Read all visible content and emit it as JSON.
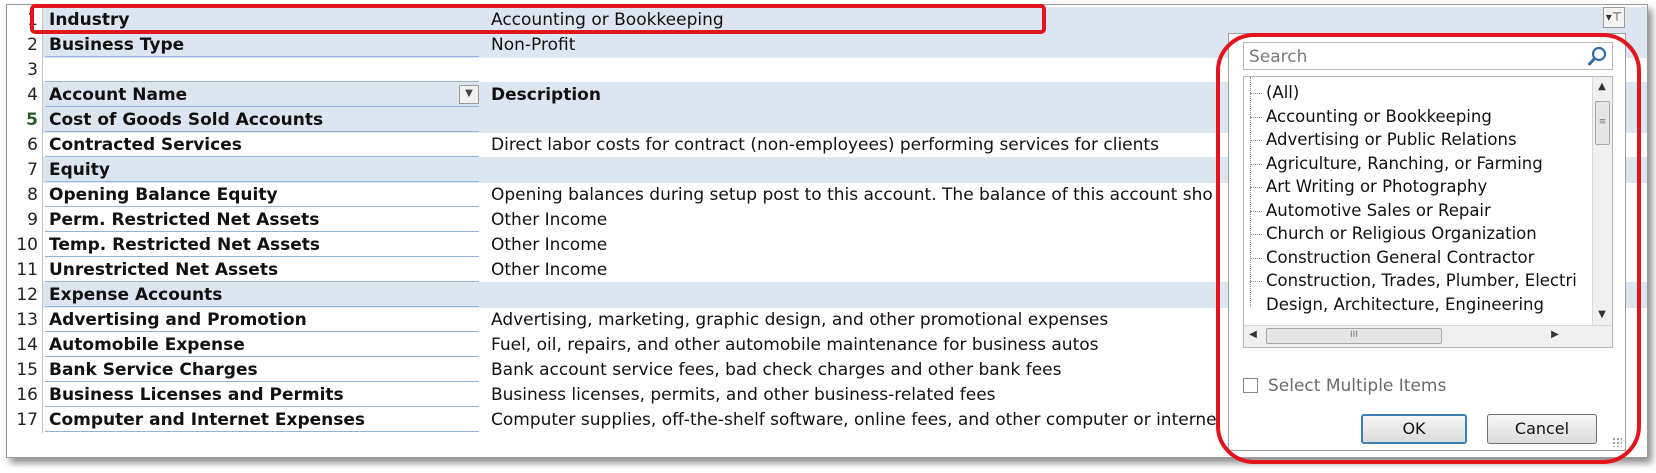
{
  "sheet": {
    "rows": [
      {
        "num": "1",
        "a": "Industry",
        "b": "Accounting or Bookkeeping",
        "band": true,
        "sel": false
      },
      {
        "num": "2",
        "a": "Business Type",
        "b": "Non-Profit",
        "band": true,
        "sel": false
      },
      {
        "num": "3",
        "a": "",
        "b": "",
        "band": false,
        "sel": false
      },
      {
        "num": "4",
        "a": "Account Name",
        "b": "Description",
        "band": true,
        "sel": false
      },
      {
        "num": "5",
        "a": "Cost of Goods Sold Accounts",
        "b": "",
        "band": true,
        "sel": true
      },
      {
        "num": "6",
        "a": "Contracted Services",
        "b": "Direct labor costs for contract (non-employees) performing services for clients",
        "band": false,
        "sel": false
      },
      {
        "num": "7",
        "a": "Equity",
        "b": "",
        "band": true,
        "sel": false
      },
      {
        "num": "8",
        "a": "Opening Balance Equity",
        "b": "Opening balances during setup post to this account. The balance of this account sho",
        "band": false,
        "sel": false
      },
      {
        "num": "9",
        "a": "Perm. Restricted Net Assets",
        "b": "Other Income",
        "band": false,
        "sel": false
      },
      {
        "num": "10",
        "a": "Temp. Restricted Net Assets",
        "b": "Other Income",
        "band": false,
        "sel": false
      },
      {
        "num": "11",
        "a": "Unrestricted Net Assets",
        "b": "Other Income",
        "band": false,
        "sel": false
      },
      {
        "num": "12",
        "a": "Expense Accounts",
        "b": "",
        "band": true,
        "sel": false
      },
      {
        "num": "13",
        "a": "Advertising and Promotion",
        "b": "Advertising, marketing, graphic design, and other promotional expenses",
        "band": false,
        "sel": false
      },
      {
        "num": "14",
        "a": "Automobile Expense",
        "b": "Fuel, oil, repairs, and other automobile maintenance for business autos",
        "band": false,
        "sel": false
      },
      {
        "num": "15",
        "a": "Bank Service Charges",
        "b": "Bank account service fees, bad check charges and other bank fees",
        "band": false,
        "sel": false
      },
      {
        "num": "16",
        "a": "Business Licenses and Permits",
        "b": "Business licenses, permits, and other business-related fees",
        "band": false,
        "sel": false
      },
      {
        "num": "17",
        "a": "Computer and Internet Expenses",
        "b": "Computer supplies, off-the-shelf software, online fees, and other computer or interne",
        "band": false,
        "sel": false
      }
    ]
  },
  "filter_panel": {
    "search_placeholder": "Search",
    "items": [
      "(All)",
      "Accounting or Bookkeeping",
      "Advertising or Public Relations",
      "Agriculture, Ranching, or Farming",
      "Art Writing or Photography",
      "Automotive Sales or Repair",
      "Church or Religious Organization",
      "Construction General Contractor",
      "Construction, Trades, Plumber, Electri"
    ],
    "partial_item": "Design, Architecture, Engineering",
    "multi_label": "Select Multiple Items",
    "ok_label": "OK",
    "cancel_label": "Cancel",
    "h_thumb_glyph": "III",
    "v_thumb_glyph": "≡"
  },
  "colors": {
    "band": "#dce6f1",
    "highlight": "#e3141b"
  }
}
